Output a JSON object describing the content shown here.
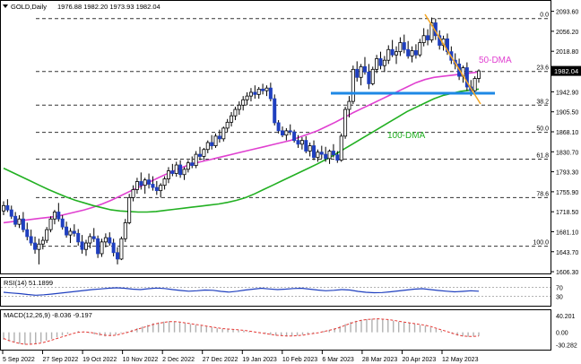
{
  "header": {
    "symbol": "GOLD,Daily",
    "ohlc": "1976.88 1982.20 1973.93 1982.04"
  },
  "chart_data": {
    "type": "candlestick",
    "main": {
      "price_ticks": [
        "2093.60",
        "2056.20",
        "2018.80",
        "1981.40",
        "1942.90",
        "1905.50",
        "1868.10",
        "1830.70",
        "1793.30",
        "1755.90",
        "1718.50",
        "1681.10",
        "1643.70",
        "1606.30"
      ],
      "ylim": [
        1598,
        2103
      ],
      "current_price": "1982.04",
      "fib_levels": [
        {
          "label": "0.0",
          "price": 2080.0
        },
        {
          "label": "23.6",
          "price": 1981.0
        },
        {
          "label": "38.2",
          "price": 1918.0
        },
        {
          "label": "50.0",
          "price": 1867.0
        },
        {
          "label": "61.8",
          "price": 1817.0
        },
        {
          "label": "78.6",
          "price": 1745.0
        },
        {
          "label": "100.0",
          "price": 1654.0
        }
      ],
      "support_level": 1942.0,
      "candles_ohlc": [
        [
          1720,
          1738,
          1712,
          1730
        ],
        [
          1730,
          1742,
          1718,
          1722
        ],
        [
          1722,
          1730,
          1705,
          1710
        ],
        [
          1710,
          1718,
          1690,
          1695
        ],
        [
          1695,
          1712,
          1688,
          1705
        ],
        [
          1705,
          1718,
          1680,
          1685
        ],
        [
          1685,
          1698,
          1665,
          1672
        ],
        [
          1672,
          1685,
          1655,
          1660
        ],
        [
          1660,
          1672,
          1640,
          1648
        ],
        [
          1648,
          1668,
          1620,
          1658
        ],
        [
          1658,
          1672,
          1648,
          1665
        ],
        [
          1665,
          1690,
          1660,
          1685
        ],
        [
          1685,
          1710,
          1680,
          1705
        ],
        [
          1705,
          1722,
          1695,
          1718
        ],
        [
          1718,
          1735,
          1700,
          1705
        ],
        [
          1705,
          1712,
          1685,
          1690
        ],
        [
          1690,
          1700,
          1670,
          1675
        ],
        [
          1675,
          1688,
          1660,
          1682
        ],
        [
          1682,
          1695,
          1672,
          1678
        ],
        [
          1678,
          1686,
          1655,
          1662
        ],
        [
          1662,
          1675,
          1640,
          1648
        ],
        [
          1648,
          1666,
          1636,
          1660
        ],
        [
          1660,
          1678,
          1650,
          1672
        ],
        [
          1672,
          1688,
          1662,
          1668
        ],
        [
          1668,
          1674,
          1632,
          1640
        ],
        [
          1640,
          1668,
          1634,
          1662
        ],
        [
          1662,
          1678,
          1652,
          1670
        ],
        [
          1670,
          1680,
          1655,
          1660
        ],
        [
          1660,
          1668,
          1635,
          1642
        ],
        [
          1642,
          1652,
          1620,
          1630
        ],
        [
          1630,
          1672,
          1628,
          1668
        ],
        [
          1668,
          1705,
          1662,
          1698
        ],
        [
          1698,
          1752,
          1695,
          1745
        ],
        [
          1745,
          1768,
          1738,
          1760
        ],
        [
          1760,
          1782,
          1752,
          1775
        ],
        [
          1775,
          1792,
          1760,
          1768
        ],
        [
          1768,
          1782,
          1752,
          1778
        ],
        [
          1778,
          1790,
          1762,
          1770
        ],
        [
          1770,
          1785,
          1758,
          1764
        ],
        [
          1764,
          1776,
          1750,
          1758
        ],
        [
          1758,
          1772,
          1745,
          1768
        ],
        [
          1768,
          1785,
          1760,
          1780
        ],
        [
          1780,
          1802,
          1772,
          1795
        ],
        [
          1795,
          1808,
          1785,
          1790
        ],
        [
          1790,
          1812,
          1784,
          1806
        ],
        [
          1806,
          1815,
          1782,
          1788
        ],
        [
          1788,
          1802,
          1778,
          1798
        ],
        [
          1798,
          1815,
          1792,
          1810
        ],
        [
          1810,
          1822,
          1800,
          1805
        ],
        [
          1805,
          1832,
          1800,
          1826
        ],
        [
          1826,
          1840,
          1815,
          1822
        ],
        [
          1822,
          1838,
          1815,
          1835
        ],
        [
          1835,
          1852,
          1828,
          1848
        ],
        [
          1848,
          1862,
          1835,
          1842
        ],
        [
          1842,
          1865,
          1838,
          1860
        ],
        [
          1860,
          1872,
          1848,
          1855
        ],
        [
          1855,
          1878,
          1850,
          1875
        ],
        [
          1875,
          1892,
          1868,
          1886
        ],
        [
          1886,
          1905,
          1878,
          1898
        ],
        [
          1898,
          1915,
          1890,
          1910
        ],
        [
          1910,
          1925,
          1900,
          1918
        ],
        [
          1918,
          1935,
          1908,
          1928
        ],
        [
          1928,
          1942,
          1918,
          1935
        ],
        [
          1935,
          1950,
          1925,
          1942
        ],
        [
          1942,
          1955,
          1930,
          1938
        ],
        [
          1938,
          1952,
          1930,
          1948
        ],
        [
          1948,
          1958,
          1938,
          1945
        ],
        [
          1945,
          1955,
          1935,
          1950
        ],
        [
          1950,
          1960,
          1925,
          1930
        ],
        [
          1930,
          1938,
          1880,
          1885
        ],
        [
          1885,
          1890,
          1865,
          1870
        ],
        [
          1870,
          1878,
          1858,
          1862
        ],
        [
          1862,
          1875,
          1852,
          1870
        ],
        [
          1870,
          1882,
          1862,
          1868
        ],
        [
          1868,
          1872,
          1848,
          1852
        ],
        [
          1852,
          1862,
          1838,
          1845
        ],
        [
          1845,
          1858,
          1835,
          1852
        ],
        [
          1852,
          1860,
          1828,
          1832
        ],
        [
          1832,
          1848,
          1822,
          1842
        ],
        [
          1842,
          1852,
          1815,
          1820
        ],
        [
          1820,
          1835,
          1812,
          1830
        ],
        [
          1830,
          1842,
          1818,
          1826
        ],
        [
          1826,
          1840,
          1812,
          1818
        ],
        [
          1818,
          1835,
          1808,
          1832
        ],
        [
          1832,
          1845,
          1820,
          1825
        ],
        [
          1825,
          1832,
          1810,
          1815
        ],
        [
          1815,
          1865,
          1812,
          1860
        ],
        [
          1860,
          1915,
          1855,
          1910
        ],
        [
          1910,
          1935,
          1895,
          1925
        ],
        [
          1925,
          1992,
          1920,
          1985
        ],
        [
          1985,
          2000,
          1962,
          1970
        ],
        [
          1970,
          1995,
          1955,
          1990
        ],
        [
          1990,
          2008,
          1975,
          1980
        ],
        [
          1980,
          1995,
          1948,
          1958
        ],
        [
          1958,
          1990,
          1955,
          1985
        ],
        [
          1985,
          2012,
          1978,
          2005
        ],
        [
          2005,
          2018,
          1985,
          1992
        ],
        [
          1992,
          2010,
          1980,
          2002
        ],
        [
          2002,
          2030,
          1995,
          2022
        ],
        [
          2022,
          2040,
          2008,
          2012
        ],
        [
          2012,
          2028,
          1995,
          2018
        ],
        [
          2018,
          2045,
          2010,
          2035
        ],
        [
          2035,
          2050,
          2015,
          2022
        ],
        [
          2022,
          2038,
          2005,
          2010
        ],
        [
          2010,
          2028,
          1998,
          2020
        ],
        [
          2020,
          2032,
          2005,
          2012
        ],
        [
          2012,
          2042,
          2008,
          2035
        ],
        [
          2035,
          2062,
          2028,
          2048
        ],
        [
          2048,
          2060,
          2030,
          2040
        ],
        [
          2040,
          2082,
          2035,
          2072
        ],
        [
          2072,
          2080,
          2040,
          2048
        ],
        [
          2048,
          2058,
          2022,
          2030
        ],
        [
          2030,
          2048,
          2020,
          2042
        ],
        [
          2042,
          2052,
          2012,
          2018
        ],
        [
          2018,
          2028,
          1995,
          2002
        ],
        [
          2002,
          2015,
          1985,
          1995
        ],
        [
          1995,
          2005,
          1965,
          1972
        ],
        [
          1972,
          1992,
          1960,
          1988
        ],
        [
          1988,
          1998,
          1945,
          1952
        ],
        [
          1952,
          1965,
          1935,
          1945
        ],
        [
          1945,
          1972,
          1940,
          1968
        ],
        [
          1968,
          1985,
          1960,
          1982
        ]
      ],
      "series": [
        {
          "name": "50-DMA",
          "color": "#e040d0",
          "values": [
            1698,
            1700,
            1702,
            1704,
            1706,
            1708,
            1710,
            1714,
            1718,
            1722,
            1727,
            1733,
            1740,
            1748,
            1756,
            1764,
            1772,
            1780,
            1788,
            1795,
            1802,
            1808,
            1812,
            1816,
            1820,
            1824,
            1828,
            1832,
            1836,
            1840,
            1844,
            1848,
            1852,
            1858,
            1864,
            1870,
            1878,
            1886,
            1895,
            1904,
            1912,
            1920,
            1928,
            1936,
            1944,
            1952,
            1960,
            1966,
            1970,
            1972,
            1974,
            1976,
            1978,
            1980
          ]
        },
        {
          "name": "100-DMA",
          "color": "#22b022",
          "values": [
            1800,
            1792,
            1784,
            1776,
            1768,
            1760,
            1753,
            1746,
            1740,
            1735,
            1730,
            1726,
            1722,
            1720,
            1719,
            1718,
            1718,
            1719,
            1721,
            1723,
            1725,
            1727,
            1729,
            1731,
            1733,
            1736,
            1740,
            1745,
            1752,
            1760,
            1768,
            1776,
            1784,
            1792,
            1800,
            1808,
            1817,
            1826,
            1836,
            1846,
            1856,
            1866,
            1876,
            1886,
            1896,
            1906,
            1914,
            1922,
            1930,
            1936,
            1940,
            1944,
            1946,
            1948
          ]
        }
      ],
      "annotations": [
        "50-DMA",
        "100-DMA"
      ]
    },
    "rsi": {
      "label": "RSI(14) 51.1899",
      "levels": [
        "70",
        "30"
      ],
      "ylim": [
        0,
        100
      ],
      "values": [
        48,
        45,
        42,
        38,
        35,
        37,
        40,
        44,
        48,
        52,
        56,
        60,
        63,
        66,
        68,
        66,
        62,
        60,
        64,
        67,
        65,
        60,
        56,
        53,
        55,
        58,
        57,
        52,
        49,
        53,
        58,
        62,
        66,
        63,
        60,
        62,
        65,
        66,
        62,
        58,
        55,
        57,
        60,
        58,
        52,
        48,
        46,
        47,
        50,
        54,
        58,
        62,
        64,
        60,
        56,
        53,
        50,
        52,
        55,
        53
      ]
    },
    "macd": {
      "label": "MACD(12,26,9) -8.036 -9.197",
      "ticks": [
        "40.201",
        "0.00",
        "-30.282"
      ],
      "ylim": [
        -40,
        45
      ],
      "histogram": [
        -18,
        -22,
        -25,
        -28,
        -30,
        -29,
        -27,
        -24,
        -20,
        -16,
        -12,
        -8,
        -4,
        0,
        3,
        2,
        -2,
        -5,
        -8,
        -10,
        -9,
        -6,
        -2,
        2,
        6,
        10,
        14,
        18,
        22,
        24,
        26,
        27,
        26,
        24,
        22,
        20,
        18,
        16,
        14,
        12,
        10,
        8,
        7,
        6,
        5,
        4,
        2,
        0,
        -2,
        -4,
        -6,
        -8,
        -9,
        -10,
        -9,
        -8,
        -6,
        -4,
        -2,
        0,
        3,
        6,
        10,
        15,
        20,
        25,
        28,
        30,
        32,
        33,
        33,
        32,
        30,
        28,
        26,
        24,
        22,
        20,
        18,
        16,
        12,
        8,
        4,
        0,
        -4,
        -8,
        -10,
        -11,
        -10,
        -9
      ],
      "signal": [
        -15,
        -20,
        -24,
        -27,
        -29,
        -29,
        -28,
        -26,
        -23,
        -19,
        -15,
        -11,
        -7,
        -3,
        0,
        1,
        0,
        -2,
        -5,
        -7,
        -8,
        -7,
        -4,
        -1,
        3,
        7,
        11,
        15,
        19,
        22,
        24,
        26,
        26,
        25,
        23,
        21,
        19,
        17,
        15,
        13,
        11,
        9,
        8,
        7,
        6,
        5,
        3,
        1,
        -1,
        -3,
        -5,
        -7,
        -8,
        -9,
        -9,
        -8,
        -7,
        -5,
        -3,
        -1,
        2,
        5,
        8,
        12,
        17,
        22,
        26,
        29,
        31,
        32,
        33,
        32,
        31,
        29,
        27,
        25,
        23,
        21,
        19,
        17,
        14,
        10,
        6,
        2,
        -2,
        -6,
        -9,
        -10,
        -10,
        -9
      ]
    },
    "x_ticks": [
      "5 Sep 2022",
      "27 Sep 2022",
      "19 Oct 2022",
      "10 Nov 2022",
      "2 Dec 2022",
      "27 Dec 2022",
      "19 Jan 2023",
      "10 Feb 2023",
      "6 Mar 2023",
      "28 Mar 2023",
      "20 Apr 2023",
      "12 May 2023"
    ]
  }
}
